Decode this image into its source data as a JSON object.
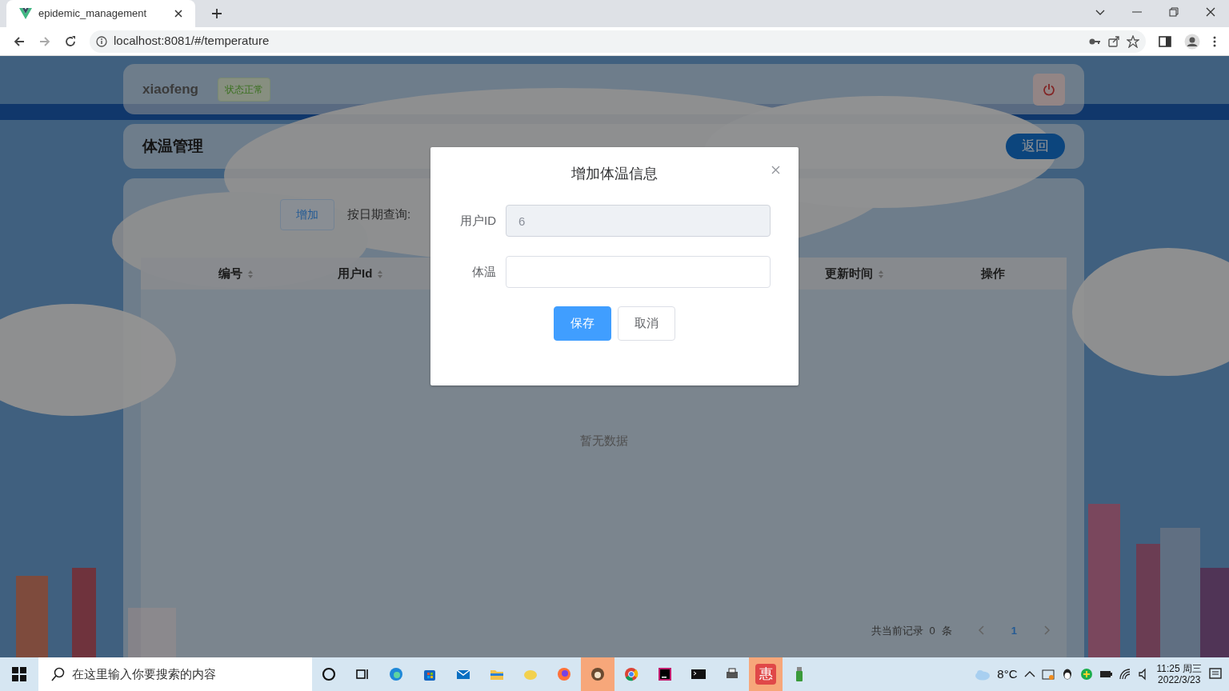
{
  "browser": {
    "tab_title": "epidemic_management",
    "url": "localhost:8081/#/temperature"
  },
  "header": {
    "username": "xiaofeng",
    "status_badge": "状态正常"
  },
  "title_bar": {
    "title": "体温管理",
    "back_button": "返回"
  },
  "toolbar": {
    "add_button": "增加",
    "date_label": "按日期查询:"
  },
  "table": {
    "columns": [
      {
        "label": "编号",
        "sortable": true
      },
      {
        "label": "用户Id",
        "sortable": true
      },
      {
        "label": "更新时间",
        "sortable": true
      },
      {
        "label": "操作",
        "sortable": false
      }
    ],
    "empty_text": "暂无数据"
  },
  "footer": {
    "record_label": "共当前记录",
    "record_count": "0",
    "record_unit": "条",
    "pages": [
      {
        "label": "1",
        "selected": true
      }
    ]
  },
  "dialog": {
    "title": "增加体温信息",
    "fields": [
      {
        "label": "用户ID",
        "value": "6",
        "disabled": true
      },
      {
        "label": "体温",
        "disabled": false
      }
    ],
    "buttons": [
      {
        "label": "保存",
        "kind": "primary"
      },
      {
        "label": "取消",
        "kind": "default"
      }
    ]
  },
  "taskbar": {
    "search_placeholder": "在这里输入你要搜索的内容",
    "app_badge": "惠",
    "weather": "8°C",
    "time": "11:25 周三",
    "date": "2022/3/23"
  }
}
